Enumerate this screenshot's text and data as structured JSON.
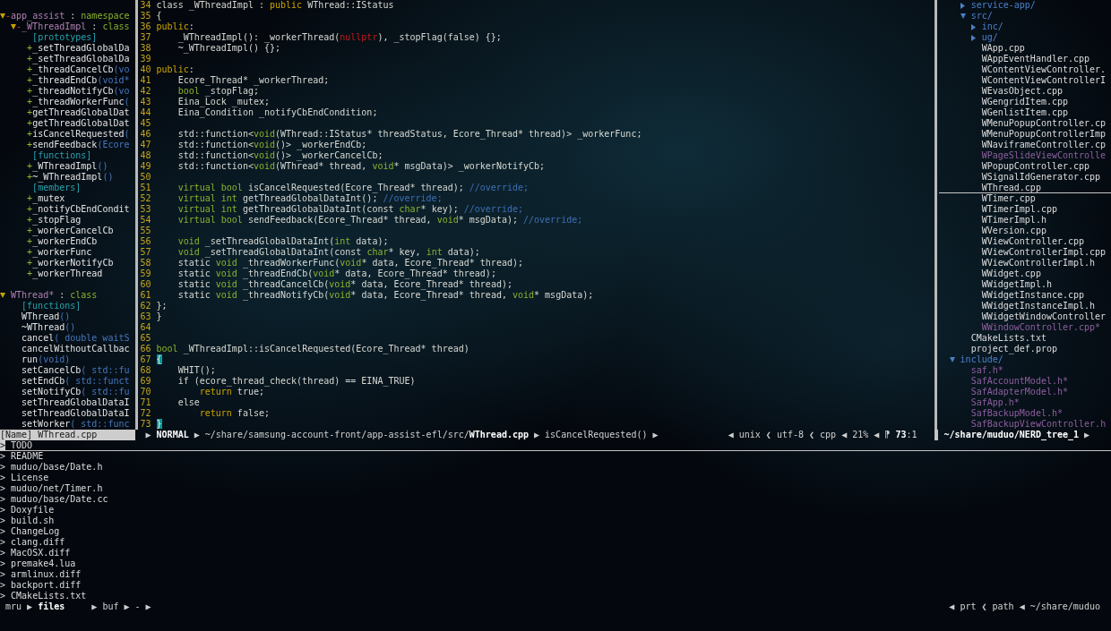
{
  "tagbar": {
    "entries": [
      {
        "kind": "scope",
        "expanded": true,
        "visibility": {
          "text": "-",
          "kind": "private"
        },
        "name": "app_assist",
        "delimiter": ":",
        "type": "namespace",
        "children": [
          {
            "kind": "scope",
            "expanded": true,
            "visibility": {
              "text": "-",
              "kind": "private"
            },
            "name": "_WThreadImpl",
            "delimiter": ":",
            "type": "class",
            "children": [
              {
                "kind": "group",
                "label": "[prototypes]",
                "children": [
                  {
                    "kind": "tag",
                    "visibility": {
                      "text": "+",
                      "kind": "public"
                    },
                    "name": "_setThreadGlobalDa"
                  },
                  {
                    "kind": "tag",
                    "visibility": {
                      "text": "+",
                      "kind": "public"
                    },
                    "name": "_setThreadGlobalDa"
                  },
                  {
                    "kind": "tag",
                    "visibility": {
                      "text": "+",
                      "kind": "public"
                    },
                    "name": "_threadCancelCb",
                    "signature": "(vo"
                  },
                  {
                    "kind": "tag",
                    "visibility": {
                      "text": "+",
                      "kind": "public"
                    },
                    "name": "_threadEndCb",
                    "signature": "(void*"
                  },
                  {
                    "kind": "tag",
                    "visibility": {
                      "text": "+",
                      "kind": "public"
                    },
                    "name": "_threadNotifyCb",
                    "signature": "(vo"
                  },
                  {
                    "kind": "tag",
                    "visibility": {
                      "text": "+",
                      "kind": "public"
                    },
                    "name": "_threadWorkerFunc",
                    "signature": "("
                  },
                  {
                    "kind": "tag",
                    "visibility": {
                      "text": "+",
                      "kind": "public"
                    },
                    "name": "getThreadGlobalDat"
                  },
                  {
                    "kind": "tag",
                    "visibility": {
                      "text": "+",
                      "kind": "public"
                    },
                    "name": "getThreadGlobalDat"
                  },
                  {
                    "kind": "tag",
                    "visibility": {
                      "text": "+",
                      "kind": "public"
                    },
                    "name": "isCancelRequested",
                    "signature": "("
                  },
                  {
                    "kind": "tag",
                    "visibility": {
                      "text": "+",
                      "kind": "public"
                    },
                    "name": "sendFeedback",
                    "signature": "(Ecore"
                  }
                ]
              },
              {
                "kind": "group",
                "label": "[functions]",
                "children": [
                  {
                    "kind": "tag",
                    "visibility": {
                      "text": "+",
                      "kind": "public"
                    },
                    "name": "_WThreadImpl",
                    "signature": "()"
                  },
                  {
                    "kind": "tag",
                    "visibility": {
                      "text": "+",
                      "kind": "public"
                    },
                    "name": "~_WThreadImpl",
                    "signature": "()"
                  }
                ]
              },
              {
                "kind": "group",
                "label": "[members]",
                "children": [
                  {
                    "kind": "tag",
                    "visibility": {
                      "text": "+",
                      "kind": "public"
                    },
                    "name": "_mutex"
                  },
                  {
                    "kind": "tag",
                    "visibility": {
                      "text": "+",
                      "kind": "public"
                    },
                    "name": "_notifyCbEndCondit"
                  },
                  {
                    "kind": "tag",
                    "visibility": {
                      "text": "+",
                      "kind": "public"
                    },
                    "name": "_stopFlag"
                  },
                  {
                    "kind": "tag",
                    "visibility": {
                      "text": "+",
                      "kind": "public"
                    },
                    "name": "_workerCancelCb"
                  },
                  {
                    "kind": "tag",
                    "visibility": {
                      "text": "+",
                      "kind": "public"
                    },
                    "name": "_workerEndCb"
                  },
                  {
                    "kind": "tag",
                    "visibility": {
                      "text": "+",
                      "kind": "public"
                    },
                    "name": "_workerFunc"
                  },
                  {
                    "kind": "tag",
                    "visibility": {
                      "text": "+",
                      "kind": "public"
                    },
                    "name": "_workerNotifyCb"
                  },
                  {
                    "kind": "tag",
                    "visibility": {
                      "text": "+",
                      "kind": "public"
                    },
                    "name": "_workerThread"
                  }
                ]
              }
            ]
          }
        ]
      },
      {
        "kind": "scope",
        "expanded": true,
        "name": "WThread*",
        "delimiter": ":",
        "type": "class",
        "children": [
          {
            "kind": "group",
            "label": "[functions]",
            "children": [
              {
                "kind": "tag",
                "name": "WThread",
                "signature": "()"
              },
              {
                "kind": "tag",
                "name": "~WThread",
                "signature": "()"
              },
              {
                "kind": "tag",
                "name": "cancel",
                "signature": "( double waitS"
              },
              {
                "kind": "tag",
                "name": "cancelWithoutCallbac"
              },
              {
                "kind": "tag",
                "name": "run",
                "signature": "(void)"
              },
              {
                "kind": "tag",
                "name": "setCancelCb",
                "signature": "( std::fu"
              },
              {
                "kind": "tag",
                "name": "setEndCb",
                "signature": "( std::funct"
              },
              {
                "kind": "tag",
                "name": "setNotifyCb",
                "signature": "( std::fu"
              },
              {
                "kind": "tag",
                "name": "setThreadGlobalDataI"
              },
              {
                "kind": "tag",
                "name": "setThreadGlobalDataI"
              },
              {
                "kind": "tag",
                "name": "setWorker",
                "signature": "( std::func"
              }
            ]
          }
        ]
      }
    ]
  },
  "editor": {
    "lines": [
      {
        "number": "34",
        "tokens": [
          {
            "kind": "plain",
            "text": "class _WThreadImpl : "
          },
          {
            "kind": "keyword",
            "text": "public"
          },
          {
            "kind": "plain",
            "text": " WThread::IStatus"
          }
        ]
      },
      {
        "number": "35",
        "tokens": [
          {
            "kind": "plain",
            "text": "{"
          }
        ]
      },
      {
        "number": "36",
        "tokens": [
          {
            "kind": "keyword",
            "text": "public"
          },
          {
            "kind": "plain",
            "text": ":"
          }
        ]
      },
      {
        "kind": "block",
        "lines": [
          {
            "number": "37",
            "tokens": [
              {
                "kind": "plain",
                "text": "_WThreadImpl(): _workerThread("
              },
              {
                "kind": "constant",
                "text": "nullptr"
              },
              {
                "kind": "plain",
                "text": "), _stopFlag(false) {};"
              }
            ]
          },
          {
            "number": "38",
            "tokens": [
              {
                "kind": "plain",
                "text": "~_WThreadImpl() {};"
              }
            ]
          }
        ]
      },
      {
        "number": "39"
      },
      {
        "number": "40",
        "tokens": [
          {
            "kind": "keyword",
            "text": "public"
          },
          {
            "kind": "plain",
            "text": ":"
          }
        ]
      },
      {
        "kind": "block",
        "lines": [
          {
            "number": "41",
            "tokens": [
              {
                "kind": "plain",
                "text": "Ecore_Thread* _workerThread;"
              }
            ]
          },
          {
            "number": "42",
            "tokens": [
              {
                "kind": "type",
                "text": "bool"
              },
              {
                "kind": "plain",
                "text": " _stopFlag;"
              }
            ]
          },
          {
            "number": "43",
            "tokens": [
              {
                "kind": "plain",
                "text": "Eina_Lock _mutex;"
              }
            ]
          },
          {
            "number": "44",
            "tokens": [
              {
                "kind": "plain",
                "text": "Eina_Condition _notifyCbEndCondition;"
              }
            ]
          },
          {
            "number": "45"
          },
          {
            "number": "46",
            "tokens": [
              {
                "kind": "plain",
                "text": "std::function<"
              },
              {
                "kind": "type",
                "text": "void"
              },
              {
                "kind": "plain",
                "text": "(WThread::IStatus* threadStatus, Ecore_Thread* thread)> _workerFunc;"
              }
            ]
          },
          {
            "number": "47",
            "tokens": [
              {
                "kind": "plain",
                "text": "std::function<"
              },
              {
                "kind": "type",
                "text": "void"
              },
              {
                "kind": "plain",
                "text": "()> _workerEndCb;"
              }
            ]
          },
          {
            "number": "48",
            "tokens": [
              {
                "kind": "plain",
                "text": "std::function<"
              },
              {
                "kind": "type",
                "text": "void"
              },
              {
                "kind": "plain",
                "text": "()> _workerCancelCb;"
              }
            ]
          },
          {
            "number": "49",
            "tokens": [
              {
                "kind": "plain",
                "text": "std::function<"
              },
              {
                "kind": "type",
                "text": "void"
              },
              {
                "kind": "plain",
                "text": "(WThread* thread, "
              },
              {
                "kind": "type",
                "text": "void"
              },
              {
                "kind": "plain",
                "text": "* msgData)> _workerNotifyCb;"
              }
            ]
          },
          {
            "number": "50"
          },
          {
            "number": "51",
            "tokens": [
              {
                "kind": "type",
                "text": "virtual bool"
              },
              {
                "kind": "plain",
                "text": " isCancelRequested(Ecore_Thread* thread); "
              },
              {
                "kind": "comment",
                "text": "//override;"
              }
            ]
          },
          {
            "number": "52",
            "tokens": [
              {
                "kind": "type",
                "text": "virtual int"
              },
              {
                "kind": "plain",
                "text": " getThreadGlobalDataInt(); "
              },
              {
                "kind": "comment",
                "text": "//override;"
              }
            ]
          },
          {
            "number": "53",
            "tokens": [
              {
                "kind": "type",
                "text": "virtual int"
              },
              {
                "kind": "plain",
                "text": " getThreadGlobalDataInt(const "
              },
              {
                "kind": "type",
                "text": "char"
              },
              {
                "kind": "plain",
                "text": "* key); "
              },
              {
                "kind": "comment",
                "text": "//override;"
              }
            ]
          },
          {
            "number": "54",
            "tokens": [
              {
                "kind": "type",
                "text": "virtual bool"
              },
              {
                "kind": "plain",
                "text": " sendFeedback(Ecore_Thread* thread, "
              },
              {
                "kind": "type",
                "text": "void"
              },
              {
                "kind": "plain",
                "text": "* msgData); "
              },
              {
                "kind": "comment",
                "text": "//override;"
              }
            ]
          },
          {
            "number": "55"
          },
          {
            "number": "56",
            "tokens": [
              {
                "kind": "type",
                "text": "void"
              },
              {
                "kind": "plain",
                "text": " _setThreadGlobalDataInt("
              },
              {
                "kind": "type",
                "text": "int"
              },
              {
                "kind": "plain",
                "text": " data);"
              }
            ]
          },
          {
            "number": "57",
            "tokens": [
              {
                "kind": "type",
                "text": "void"
              },
              {
                "kind": "plain",
                "text": " _setThreadGlobalDataInt(const "
              },
              {
                "kind": "type",
                "text": "char"
              },
              {
                "kind": "plain",
                "text": "* key, "
              },
              {
                "kind": "type",
                "text": "int"
              },
              {
                "kind": "plain",
                "text": " data);"
              }
            ]
          },
          {
            "number": "58",
            "tokens": [
              {
                "kind": "plain",
                "text": "static "
              },
              {
                "kind": "type",
                "text": "void"
              },
              {
                "kind": "plain",
                "text": " _threadWorkerFunc("
              },
              {
                "kind": "type",
                "text": "void"
              },
              {
                "kind": "plain",
                "text": "* data, Ecore_Thread* thread);"
              }
            ]
          },
          {
            "number": "59",
            "tokens": [
              {
                "kind": "plain",
                "text": "static "
              },
              {
                "kind": "type",
                "text": "void"
              },
              {
                "kind": "plain",
                "text": " _threadEndCb("
              },
              {
                "kind": "type",
                "text": "void"
              },
              {
                "kind": "plain",
                "text": "* data, Ecore_Thread* thread);"
              }
            ]
          },
          {
            "number": "60",
            "tokens": [
              {
                "kind": "plain",
                "text": "static "
              },
              {
                "kind": "type",
                "text": "void"
              },
              {
                "kind": "plain",
                "text": " _threadCancelCb("
              },
              {
                "kind": "type",
                "text": "void"
              },
              {
                "kind": "plain",
                "text": "* data, Ecore_Thread* thread);"
              }
            ]
          },
          {
            "number": "61",
            "tokens": [
              {
                "kind": "plain",
                "text": "static "
              },
              {
                "kind": "type",
                "text": "void"
              },
              {
                "kind": "plain",
                "text": " _threadNotifyCb("
              },
              {
                "kind": "type",
                "text": "void"
              },
              {
                "kind": "plain",
                "text": "* data, Ecore_Thread* thread, "
              },
              {
                "kind": "type",
                "text": "void"
              },
              {
                "kind": "plain",
                "text": "* msgData);"
              }
            ]
          }
        ]
      },
      {
        "number": "62",
        "tokens": [
          {
            "kind": "plain",
            "text": "};"
          }
        ]
      },
      {
        "number": "63",
        "tokens": [
          {
            "kind": "plain",
            "text": "}"
          }
        ]
      },
      {
        "number": "64"
      },
      {
        "number": "65"
      },
      {
        "number": "66",
        "tokens": [
          {
            "kind": "type",
            "text": "bool"
          },
          {
            "kind": "plain",
            "text": " _WThreadImpl::isCancelRequested(Ecore_Thread* thread)"
          }
        ]
      },
      {
        "number": "67",
        "tokens": [
          {
            "kind": "match",
            "text": "{"
          }
        ]
      },
      {
        "kind": "block",
        "lines": [
          {
            "number": "68",
            "tokens": [
              {
                "kind": "plain",
                "text": "WHIT();"
              }
            ]
          },
          {
            "number": "69",
            "tokens": [
              {
                "kind": "plain",
                "text": "if (ecore_thread_check(thread) == EINA_TRUE)"
              }
            ]
          },
          {
            "kind": "block",
            "lines": [
              {
                "number": "70",
                "tokens": [
                  {
                    "kind": "keyword",
                    "text": "return"
                  },
                  {
                    "kind": "plain",
                    "text": " true;"
                  }
                ]
              }
            ]
          },
          {
            "number": "71",
            "tokens": [
              {
                "kind": "plain",
                "text": "else"
              }
            ]
          },
          {
            "kind": "block",
            "lines": [
              {
                "number": "72",
                "tokens": [
                  {
                    "kind": "keyword",
                    "text": "return"
                  },
                  {
                    "kind": "plain",
                    "text": " false;"
                  }
                ]
              }
            ]
          }
        ]
      },
      {
        "number": "73",
        "tokens": [
          {
            "kind": "match",
            "text": "}"
          }
        ]
      }
    ]
  },
  "nerdtree": {
    "tree": [
      {
        "children": [
          {
            "children": [
              {
                "kind": "dir",
                "name": "service-app/",
                "expanded": false,
                "selected": false
              },
              {
                "kind": "dir",
                "name": "src/",
                "expanded": true,
                "selected": false,
                "children": [
                  {
                    "kind": "dir",
                    "name": "inc/",
                    "expanded": false,
                    "selected": false
                  },
                  {
                    "kind": "dir",
                    "name": "ug/",
                    "expanded": false,
                    "selected": false
                  },
                  {
                    "kind": "file",
                    "name": "WApp.cpp",
                    "executable": false,
                    "selected": false
                  },
                  {
                    "kind": "file",
                    "name": "WAppEventHandler.cpp",
                    "executable": false,
                    "selected": false
                  },
                  {
                    "kind": "file",
                    "name": "WContentViewController.",
                    "executable": false,
                    "selected": false
                  },
                  {
                    "kind": "file",
                    "name": "WContentViewControllerI",
                    "executable": false,
                    "selected": false
                  },
                  {
                    "kind": "file",
                    "name": "WEvasObject.cpp",
                    "executable": false,
                    "selected": false
                  },
                  {
                    "kind": "file",
                    "name": "WGengridItem.cpp",
                    "executable": false,
                    "selected": false
                  },
                  {
                    "kind": "file",
                    "name": "WGenlistItem.cpp",
                    "executable": false,
                    "selected": false
                  },
                  {
                    "kind": "file",
                    "name": "WMenuPopupController.cp",
                    "executable": false,
                    "selected": false
                  },
                  {
                    "kind": "file",
                    "name": "WMenuPopupControllerImp",
                    "executable": false,
                    "selected": false
                  },
                  {
                    "kind": "file",
                    "name": "WNaviframeController.cp",
                    "executable": false,
                    "selected": false
                  },
                  {
                    "kind": "file",
                    "name": "WPageSlideViewControlle",
                    "executable": true,
                    "selected": false
                  },
                  {
                    "kind": "file",
                    "name": "WPopupController.cpp",
                    "executable": false,
                    "selected": false
                  },
                  {
                    "kind": "file",
                    "name": "WSignalIdGenerator.cpp",
                    "executable": false,
                    "selected": false
                  },
                  {
                    "kind": "file",
                    "name": "WThread.cpp",
                    "executable": false,
                    "selected": true
                  },
                  {
                    "kind": "file",
                    "name": "WTimer.cpp",
                    "executable": false,
                    "selected": false
                  },
                  {
                    "kind": "file",
                    "name": "WTimerImpl.cpp",
                    "executable": false,
                    "selected": false
                  },
                  {
                    "kind": "file",
                    "name": "WTimerImpl.h",
                    "executable": false,
                    "selected": false
                  },
                  {
                    "kind": "file",
                    "name": "WVersion.cpp",
                    "executable": false,
                    "selected": false
                  },
                  {
                    "kind": "file",
                    "name": "WViewController.cpp",
                    "executable": false,
                    "selected": false
                  },
                  {
                    "kind": "file",
                    "name": "WViewControllerImpl.cpp",
                    "executable": false,
                    "selected": false
                  },
                  {
                    "kind": "file",
                    "name": "WViewControllerImpl.h",
                    "executable": false,
                    "selected": false
                  },
                  {
                    "kind": "file",
                    "name": "WWidget.cpp",
                    "executable": false,
                    "selected": false
                  },
                  {
                    "kind": "file",
                    "name": "WWidgetImpl.h",
                    "executable": false,
                    "selected": false
                  },
                  {
                    "kind": "file",
                    "name": "WWidgetInstance.cpp",
                    "executable": false,
                    "selected": false
                  },
                  {
                    "kind": "file",
                    "name": "WWidgetInstanceImpl.h",
                    "executable": false,
                    "selected": false
                  },
                  {
                    "kind": "file",
                    "name": "WWidgetWindowController",
                    "executable": false,
                    "selected": false
                  },
                  {
                    "kind": "file",
                    "name": "WWindowController.cpp*",
                    "executable": true,
                    "selected": false
                  }
                ]
              },
              {
                "kind": "file",
                "name": "CMakeLists.txt",
                "executable": false,
                "selected": false
              },
              {
                "kind": "file",
                "name": "project_def.prop",
                "executable": false,
                "selected": false
              }
            ]
          },
          {
            "kind": "dir",
            "name": "include/",
            "expanded": true,
            "selected": false,
            "children": [
              {
                "kind": "file",
                "name": "saf.h*",
                "executable": true,
                "selected": false
              },
              {
                "kind": "file",
                "name": "SafAccountModel.h*",
                "executable": true,
                "selected": false
              },
              {
                "kind": "file",
                "name": "SafAdapterModel.h*",
                "executable": true,
                "selected": false
              },
              {
                "kind": "file",
                "name": "SafApp.h*",
                "executable": true,
                "selected": false
              },
              {
                "kind": "file",
                "name": "SafBackupModel.h*",
                "executable": true,
                "selected": false
              },
              {
                "kind": "file",
                "name": "SafBackupViewController.h",
                "executable": true,
                "selected": false
              }
            ]
          }
        ]
      }
    ]
  },
  "statusline": {
    "tagbar": "[Name] WThread.cpp",
    "left": [
      {
        "kind": "sep",
        "text": "▶"
      },
      {
        "kind": "bold",
        "text": "NORMAL"
      },
      {
        "kind": "sep",
        "text": "▶"
      },
      {
        "kind": "text",
        "text": "~/share/samsung-account-front/app-assist-efl/src/**WThread.cpp**"
      },
      {
        "kind": "sep",
        "text": "▶"
      },
      {
        "kind": "text",
        "text": "isCancelRequested()"
      },
      {
        "kind": "sep",
        "text": "▶"
      }
    ],
    "right": [
      {
        "kind": "sep",
        "text": "◀"
      },
      {
        "kind": "text",
        "text": "unix"
      },
      {
        "kind": "softsep",
        "text": "❮"
      },
      {
        "kind": "text",
        "text": "utf-8"
      },
      {
        "kind": "softsep",
        "text": "❮"
      },
      {
        "kind": "text",
        "text": "cpp"
      },
      {
        "kind": "sep",
        "text": "◀"
      },
      {
        "kind": "text",
        "text": "21%"
      },
      {
        "kind": "sep",
        "text": "◀"
      },
      {
        "kind": "symbol",
        "text": "⁋"
      },
      {
        "kind": "text",
        "text": "**73**:1"
      }
    ],
    "nerdtree": [
      {
        "kind": "bold",
        "text": "~/share/muduo/NERD_tree_1"
      },
      {
        "kind": "sep",
        "text": "▶"
      }
    ]
  },
  "ctrlp": {
    "items": [
      {
        "prefix": ">",
        "text": "TODO",
        "selected": true
      },
      {
        "prefix": ">",
        "text": "README",
        "selected": false
      },
      {
        "prefix": ">",
        "text": "muduo/base/Date.h",
        "selected": false
      },
      {
        "prefix": ">",
        "text": "License",
        "selected": false
      },
      {
        "prefix": ">",
        "text": "muduo/net/Timer.h",
        "selected": false
      },
      {
        "prefix": ">",
        "text": "muduo/base/Date.cc",
        "selected": false
      },
      {
        "prefix": ">",
        "text": "Doxyfile",
        "selected": false
      },
      {
        "prefix": ">",
        "text": "build.sh",
        "selected": false
      },
      {
        "prefix": ">",
        "text": "ChangeLog",
        "selected": false
      },
      {
        "prefix": ">",
        "text": "clang.diff",
        "selected": false
      },
      {
        "prefix": ">",
        "text": "MacOSX.diff",
        "selected": false
      },
      {
        "prefix": ">",
        "text": "premake4.lua",
        "selected": false
      },
      {
        "prefix": ">",
        "text": "armlinux.diff",
        "selected": false
      },
      {
        "prefix": ">",
        "text": "backport.diff",
        "selected": false
      },
      {
        "prefix": ">",
        "text": "CMakeLists.txt",
        "selected": false
      }
    ],
    "prompt": {
      "left": [
        {
          "kind": "text",
          "text": "mru"
        },
        {
          "kind": "sep",
          "text": "▶"
        },
        {
          "kind": "bold",
          "text": "files"
        },
        {
          "kind": "sep",
          "text": "▶"
        },
        {
          "kind": "text",
          "text": "buf"
        },
        {
          "kind": "sep",
          "text": "▶"
        },
        {
          "kind": "text",
          "text": "-"
        },
        {
          "kind": "sep",
          "text": "▶"
        }
      ],
      "right": [
        {
          "kind": "sep",
          "text": "◀"
        },
        {
          "kind": "text",
          "text": "prt"
        },
        {
          "kind": "softsep",
          "text": "❮"
        },
        {
          "kind": "text",
          "text": "path"
        },
        {
          "kind": "sep",
          "text": "◀"
        },
        {
          "kind": "text",
          "text": "~/share/muduo"
        }
      ]
    }
  }
}
